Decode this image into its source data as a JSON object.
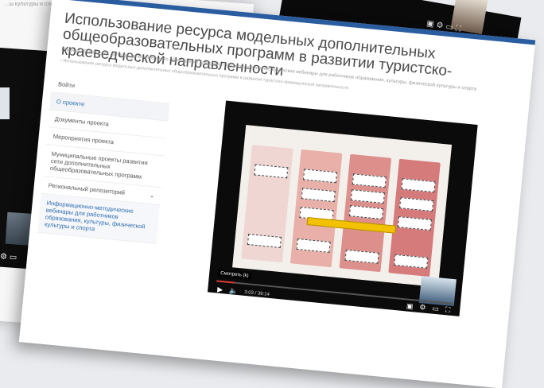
{
  "page": {
    "title": "Использование ресурса модельных дополнительных общеобразовательных программ в развитии туристско-краеведческой направленности",
    "breadcrumb_1": "Главная  ›  Проект для детского дополнительного образования для детей  ›  Информационно-методические вебинары для работников образования, культуры, физической культуры и спорта",
    "breadcrumb_2": "›  Использование ресурса модельных дополнительных общеобразовательных программ в развитии туристско-краеведческой направленности"
  },
  "sidebar": {
    "items": [
      {
        "label": "Войти"
      },
      {
        "label": "О проекте"
      },
      {
        "label": "Документы проекта"
      },
      {
        "label": "Мероприятия проекта"
      },
      {
        "label": "Муниципальные проекты развития сети дополнительных общеобразовательных программ"
      },
      {
        "label": "Региональный репозиторий"
      },
      {
        "label": "Информационно-методические вебинары для работников образования, культуры, физической культуры и спорта"
      }
    ]
  },
  "video": {
    "watch_label": "Смотреть (k)",
    "time": "3:03 / 39:14",
    "progress_fraction": 0.078
  },
  "background": {
    "crumb_left": "...ы культуры и спорта"
  },
  "colors": {
    "accent": "#2a5d9f",
    "link": "#2f6db3",
    "progress": "#e53935",
    "highlight": "#f2c200"
  }
}
